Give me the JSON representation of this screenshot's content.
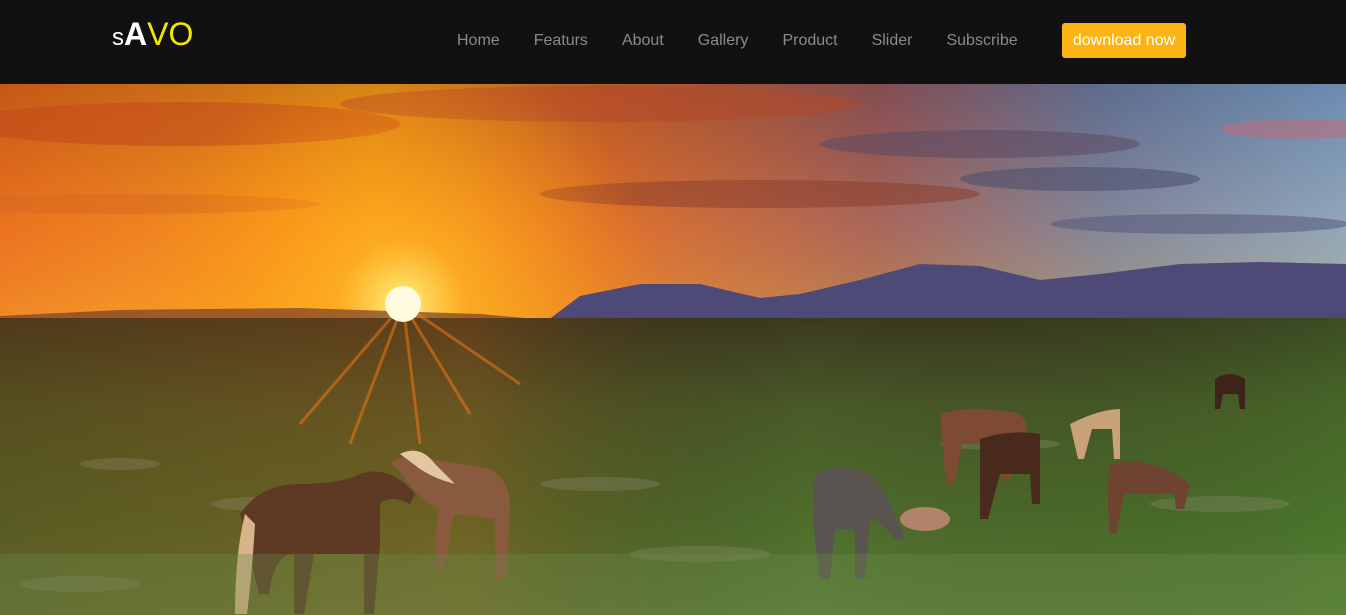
{
  "brand": {
    "logo_part1": "s",
    "logo_part2": "A",
    "logo_part3": "VO"
  },
  "nav": {
    "items": [
      {
        "label": "Home"
      },
      {
        "label": "Featurs"
      },
      {
        "label": "About"
      },
      {
        "label": "Gallery"
      },
      {
        "label": "Product"
      },
      {
        "label": "Slider"
      },
      {
        "label": "Subscribe"
      }
    ],
    "cta_label": "download now"
  },
  "colors": {
    "navbar_bg": "#111111",
    "nav_text": "#8a8a8a",
    "logo_accent": "#f5e800",
    "cta_bg": "#fbb316"
  },
  "hero": {
    "image": "sunset-horses-landscape"
  }
}
